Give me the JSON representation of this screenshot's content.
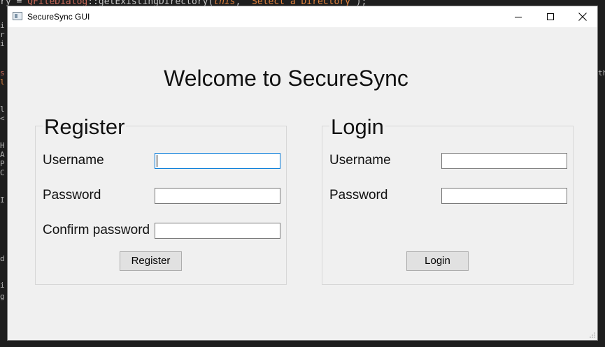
{
  "editor": {
    "top_line_prefix": "ry = ",
    "top_line_class": "QFileDialog",
    "top_line_method": "::getExistingDirectory(",
    "top_line_this": "this",
    "top_line_sep": ", ",
    "top_line_string": "\"Select a Directory\"",
    "top_line_suffix": ");",
    "gutter_fragments": [
      "i",
      "r",
      "i",
      "",
      "s",
      "l",
      "",
      "l",
      "<",
      "",
      "H",
      "A",
      "P",
      "C",
      "",
      "I",
      "",
      "",
      "",
      "",
      "d",
      "",
      "i",
      "g"
    ],
    "right_fragments": [
      "th"
    ]
  },
  "window": {
    "title": "SecureSync GUI",
    "icon": "app-window-icon"
  },
  "main": {
    "welcome": "Welcome to SecureSync"
  },
  "register": {
    "title": "Register",
    "username_label": "Username",
    "username_value": "",
    "password_label": "Password",
    "password_value": "",
    "confirm_label": "Confirm password",
    "confirm_value": "",
    "button_label": "Register"
  },
  "login": {
    "title": "Login",
    "username_label": "Username",
    "username_value": "",
    "password_label": "Password",
    "password_value": "",
    "button_label": "Login"
  },
  "colors": {
    "window_bg": "#f0f0f0",
    "focus_border": "#0078d7",
    "button_bg": "#e1e1e1"
  }
}
